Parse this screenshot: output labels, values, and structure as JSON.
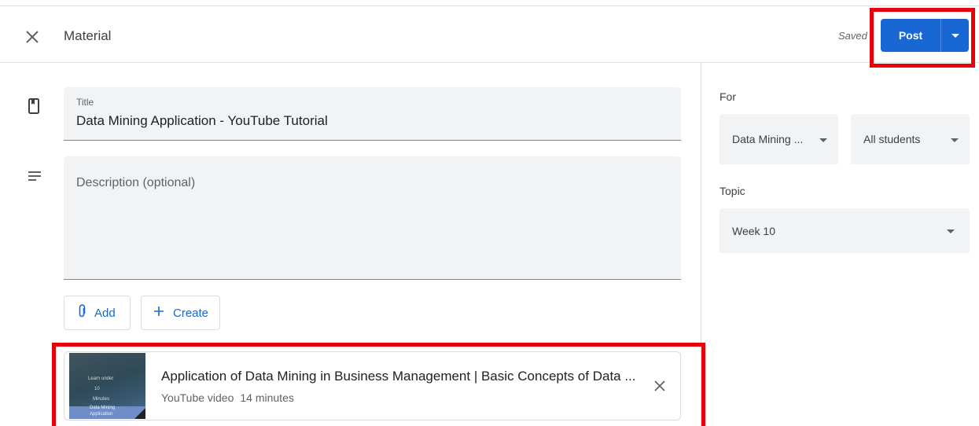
{
  "header": {
    "title": "Material",
    "saved_status": "Saved",
    "post_label": "Post"
  },
  "form": {
    "title_label": "Title",
    "title_value": "Data Mining Application - YouTube Tutorial",
    "description_placeholder": "Description (optional)",
    "add_label": "Add",
    "create_label": "Create"
  },
  "attachment": {
    "title": "Application of Data Mining in Business Management | Basic Concepts of Data ...",
    "type": "YouTube video",
    "duration": "14 minutes",
    "thumbnail_text": [
      "Learn under",
      "10",
      "Minutes",
      "Data Mining",
      "Application"
    ]
  },
  "sidebar": {
    "for_label": "For",
    "class_value": "Data Mining ...",
    "students_value": "All students",
    "topic_label": "Topic",
    "topic_value": "Week 10"
  },
  "colors": {
    "accent": "#1967d2",
    "highlight": "#e8000b",
    "field_bg": "#f1f3f4"
  },
  "icons": [
    "close-icon",
    "bookmark-icon",
    "description-lines-icon",
    "paperclip-icon",
    "plus-icon",
    "dropdown-arrow-icon"
  ]
}
